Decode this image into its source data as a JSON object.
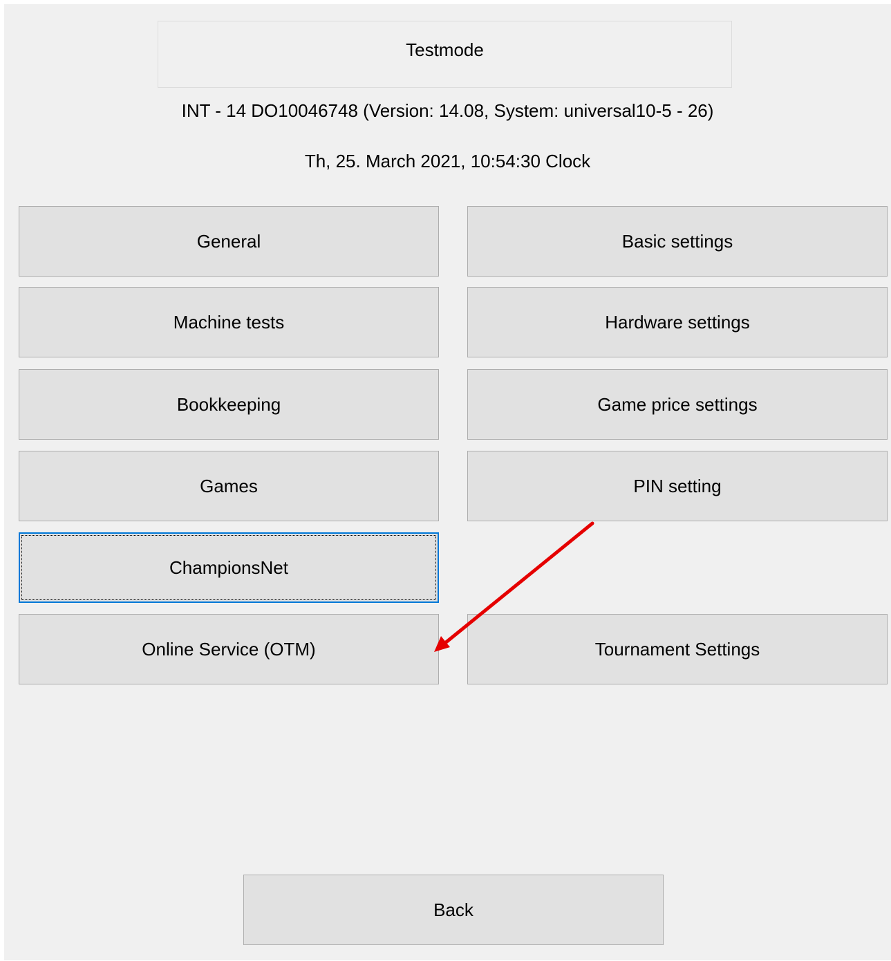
{
  "header": {
    "title": "Testmode",
    "machine_info": "INT - 14 DO10046748 (Version: 14.08, System: universal10-5 - 26)",
    "datetime": "Th, 25. March 2021, 10:54:30 Clock"
  },
  "menu": {
    "left": [
      {
        "label": "General"
      },
      {
        "label": "Machine tests"
      },
      {
        "label": "Bookkeeping"
      },
      {
        "label": "Games"
      },
      {
        "label": "ChampionsNet"
      },
      {
        "label": "Online Service (OTM)"
      }
    ],
    "right": [
      {
        "label": "Basic settings"
      },
      {
        "label": "Hardware settings"
      },
      {
        "label": "Game price settings"
      },
      {
        "label": "PIN setting"
      },
      {
        "label": "Tournament Settings"
      }
    ]
  },
  "footer": {
    "back_label": "Back"
  },
  "colors": {
    "window_bg": "#f0f0f0",
    "button_bg": "#e1e1e1",
    "button_border": "#adadad",
    "focus_border": "#0078d7",
    "annotation_arrow": "#e50000"
  }
}
